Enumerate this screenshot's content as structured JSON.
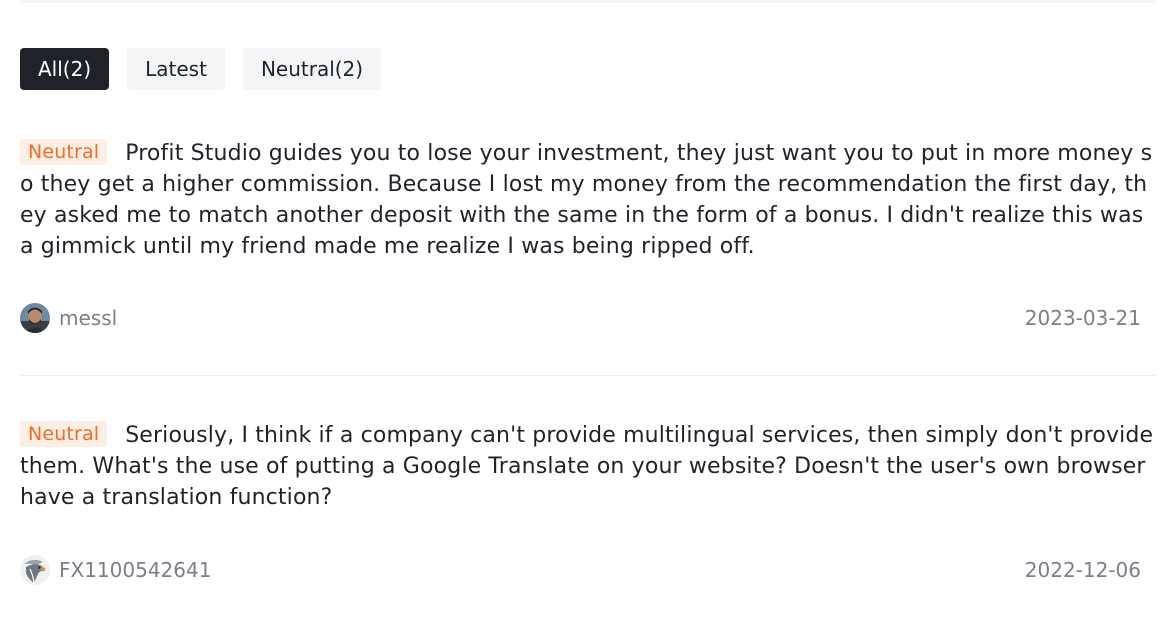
{
  "filters": {
    "all": "All(2)",
    "latest": "Latest",
    "neutral": "Neutral(2)"
  },
  "reviews": [
    {
      "rating": "Neutral",
      "text": "Profit Studio guides you to lose your investment, they just want you to put in more money so they get a higher commission. Because I lost my money from the recommendation the first day, they asked me to match another deposit with the same in the form of a bonus. I didn't realize this was a gimmick until my friend made me realize I was being ripped off.",
      "username": "messl",
      "date": "2023-03-21"
    },
    {
      "rating": "Neutral",
      "text": "Seriously, I think if a company can't provide multilingual services, then simply don't provide them. What's the use of putting a Google Translate on your website? Doesn't the user's own browser have a translation function?",
      "username": "FX1100542641",
      "date": "2022-12-06"
    }
  ],
  "colors": {
    "active_tab_bg": "#1f2329",
    "tab_bg": "#f3f4f6",
    "neutral_badge_bg": "#fdeee6",
    "neutral_badge_text": "#f26b22",
    "meta_text": "#7a7f88"
  },
  "icons": [
    "user-avatar-photo",
    "eagle-avatar-icon"
  ]
}
